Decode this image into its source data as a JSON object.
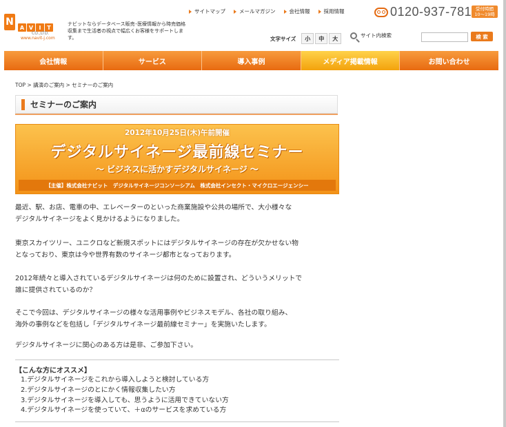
{
  "header": {
    "logo": {
      "big_letter": "N",
      "small_letters": [
        "A",
        "V",
        "I",
        "T"
      ],
      "company": "CO.,LTD.",
      "url": "www.navit-j.com"
    },
    "tagline": "ナビットならデータベース販売･医療情報から時売価格収集まで生活者の視点で幅広くお客様をサポートします。",
    "top_links": [
      "サイトマップ",
      "メールマガジン",
      "会社情報",
      "採用情報"
    ],
    "phone": "0120-937-781",
    "hours": [
      "受付時間",
      "10～19時"
    ],
    "font_size": {
      "label": "文字サイズ",
      "options": [
        "小",
        "中",
        "大"
      ]
    },
    "search": {
      "label": "サイト内検索",
      "placeholder": "",
      "button": "検 索"
    }
  },
  "main_nav": [
    {
      "label": "会社情報",
      "active": false
    },
    {
      "label": "サービス",
      "active": false
    },
    {
      "label": "導入事例",
      "active": false
    },
    {
      "label": "メディア掲載情報",
      "active": true
    },
    {
      "label": "お問い合わせ",
      "active": false
    }
  ],
  "breadcrumb": {
    "items": [
      "TOP",
      "講演のご案内",
      "セミナーのご案内"
    ],
    "separator": ">"
  },
  "page_title": "セミナーのご案内",
  "banner": {
    "date": "2012年10月25日(木)午前開催",
    "title": "デジタルサイネージ最前線セミナー",
    "subtitle": "～ ビジネスに活かすデジタルサイネージ ～",
    "organizer": "【主催】株式会社ナビット　デジタルサイネージコンソーシアム　株式会社インセクト・マイクロエージェンシー"
  },
  "body": {
    "para1": [
      "最近、駅、お店、電車の中、エレベーターのといった商業施設や公共の場所で、大小様々な",
      "デジタルサイネージをよく見かけるようになりました。"
    ],
    "para2": [
      "東京スカイツリー、ユニクロなど新規スポットにはデジタルサイネージの存在が欠かせない物",
      "となっており、東京は今や世界有数のサイネージ都市となっております。"
    ],
    "para3": [
      "2012年続々と導入されているデジタルサイネージは何のために設置され、どういうメリットで",
      "誰に提供されているのか？"
    ],
    "para4": [
      "そこで今回は、デジタルサイネージの様々な活用事例やビジネスモデル、各社の取り組み、",
      "海外の事例などを包括し「デジタルサイネージ最前線セミナー」を実施いたします。"
    ],
    "para5": "デジタルサイネージに関心のある方は是非、ご参加下さい。"
  },
  "recommend": {
    "heading": "【こんな方にオススメ】",
    "items": [
      "1.デジタルサイネージをこれから導入しようと検討している方",
      "2.デジタルサイネージのとにかく情報収集したい方",
      "3.デジタルサイネージを導入しても、思うように活用できていない方",
      "4.デジタルサイネージを使っていて、＋αのサービスを求めている方"
    ]
  },
  "colors": {
    "accent": "#ea7a1c",
    "nav_active": "#f3a20c",
    "banner": "#f39218"
  }
}
